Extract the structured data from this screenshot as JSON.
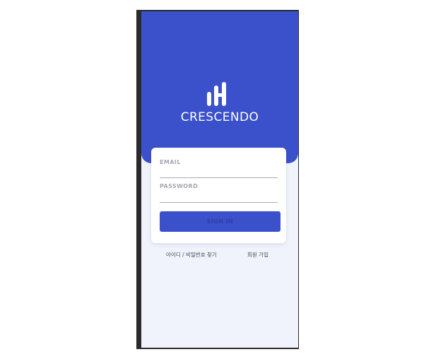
{
  "app": {
    "brand_name": "CRESCENDO",
    "logo_icon": "crescendo-bars-logo",
    "accent_color": "#3b50cb",
    "background_color": "#f1f3fc"
  },
  "login_form": {
    "email_label": "EMAIL",
    "email_value": "",
    "password_label": "PASSWORD",
    "password_value": "",
    "signin_label": "SIGN IN"
  },
  "links": {
    "find_account": "아이디 / 비밀번호 찾기",
    "signup": "회원 가입"
  }
}
